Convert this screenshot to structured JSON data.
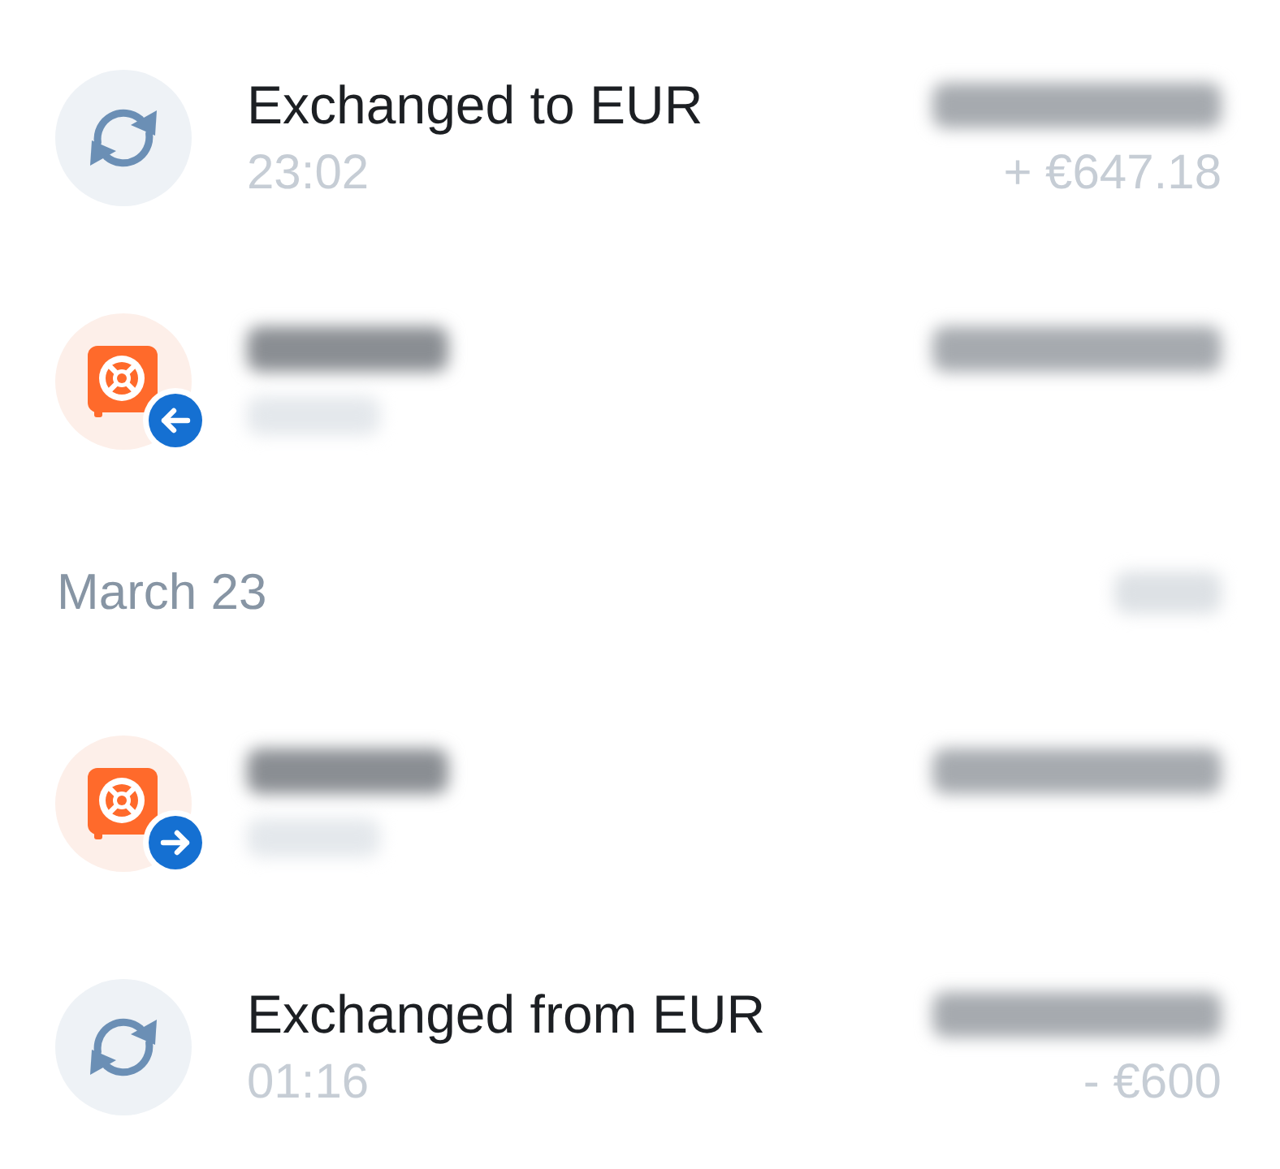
{
  "list": [
    {
      "kind": "exchange",
      "title": "Exchanged to EUR",
      "title_hidden": false,
      "time": "23:02",
      "time_hidden": false,
      "amount_hidden": true,
      "converted_amount": "+ €647.18"
    },
    {
      "kind": "withdrawal",
      "title_hidden": true,
      "time_hidden": true,
      "amount_hidden": true
    },
    {
      "kind": "date",
      "label": "March 23",
      "total_hidden": true
    },
    {
      "kind": "deposit",
      "title_hidden": true,
      "time_hidden": true,
      "amount_hidden": true
    },
    {
      "kind": "exchange",
      "title": "Exchanged from EUR",
      "title_hidden": false,
      "time": "01:16",
      "time_hidden": false,
      "amount_hidden": true,
      "converted_amount": "- €600"
    }
  ]
}
